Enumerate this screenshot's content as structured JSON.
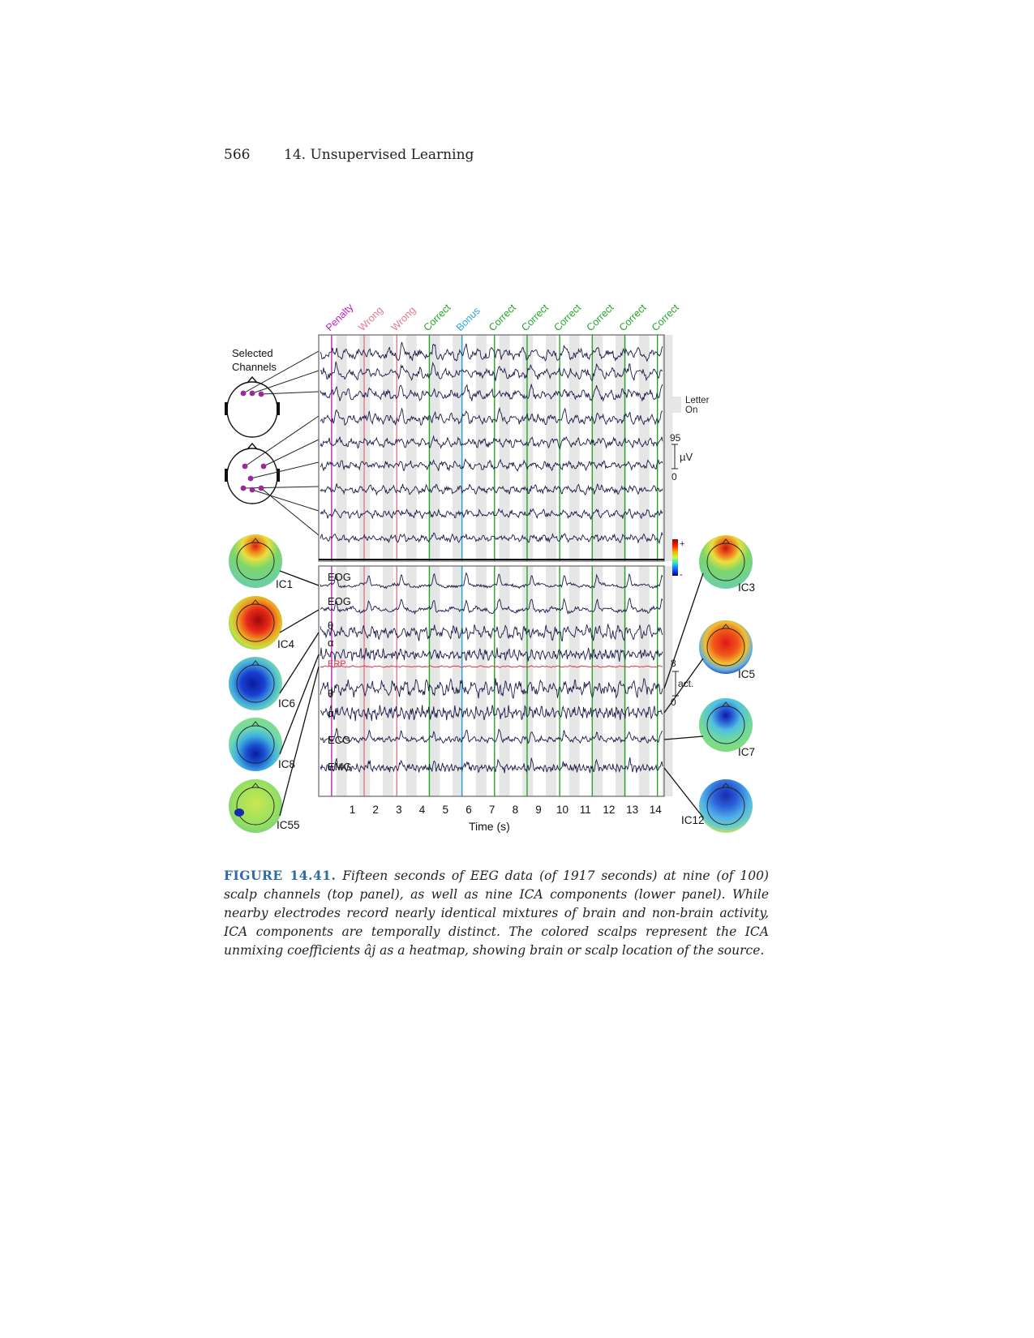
{
  "header": {
    "page_number": "566",
    "chapter": "14. Unsupervised Learning"
  },
  "figure": {
    "selected_channels_label": [
      "Selected",
      "Channels"
    ],
    "event_labels": [
      {
        "text": "Penalty",
        "color": "#c020c0"
      },
      {
        "text": "Wrong",
        "color": "#e07a8a"
      },
      {
        "text": "Wrong",
        "color": "#e07a8a"
      },
      {
        "text": "Correct",
        "color": "#22a822"
      },
      {
        "text": "Bonus",
        "color": "#22a8d8"
      },
      {
        "text": "Correct",
        "color": "#22a822"
      },
      {
        "text": "Correct",
        "color": "#22a822"
      },
      {
        "text": "Correct",
        "color": "#22a822"
      },
      {
        "text": "Correct",
        "color": "#22a822"
      },
      {
        "text": "Correct",
        "color": "#22a822"
      },
      {
        "text": "Correct",
        "color": "#22a822"
      }
    ],
    "event_times": [
      0.1,
      1.5,
      2.9,
      4.3,
      5.7,
      7.1,
      8.5,
      9.9,
      11.3,
      12.7,
      14.1
    ],
    "letter_on_label": [
      "Letter",
      "On"
    ],
    "top_scale": {
      "max": "95",
      "unit": "µV",
      "min": "0"
    },
    "colorbar": {
      "plus": "+",
      "minus": "-"
    },
    "bottom_scale": {
      "max": "8",
      "unit": "act.",
      "min": "0"
    },
    "component_labels": [
      "EOG",
      "EOG",
      "θ",
      "α",
      "ERP",
      "θ",
      "α",
      "ECG",
      "EMG"
    ],
    "ic_left": [
      "IC1",
      "IC4",
      "IC6",
      "IC8",
      "IC55"
    ],
    "ic_right": [
      "IC3",
      "IC5",
      "IC7",
      "IC12"
    ],
    "x_ticks": [
      "1",
      "2",
      "3",
      "4",
      "5",
      "6",
      "7",
      "8",
      "9",
      "10",
      "11",
      "12",
      "13",
      "14"
    ],
    "xlabel": "Time (s)",
    "colors": {
      "trace": "#1c1c4a",
      "erp": "#d83a4a",
      "electrode": "#9a2a9a",
      "frame": "#666666",
      "letter_band": "#e6e6e6"
    }
  },
  "caption": {
    "label": "FIGURE 14.41.",
    "text": "Fifteen seconds of EEG data (of 1917 seconds) at nine (of 100) scalp channels (top panel), as well as nine ICA components (lower panel). While nearby electrodes record nearly identical mixtures of brain and non-brain activity, ICA components are temporally distinct. The colored scalps represent the ICA unmixing coefficients âj as a heatmap, showing brain or scalp location of the source."
  }
}
